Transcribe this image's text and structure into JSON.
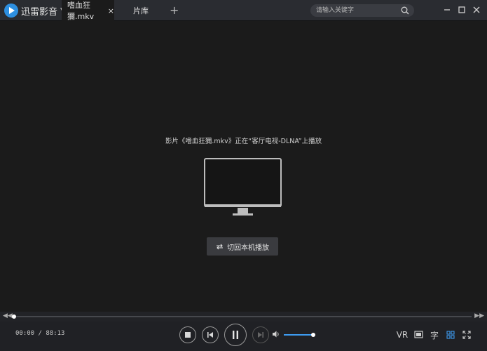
{
  "app": {
    "name": "迅雷影音",
    "brand_color": "#2d8fe0"
  },
  "tabs": [
    {
      "label": "嗜血狂獮.mkv",
      "close": "×"
    },
    {
      "label": "片库"
    }
  ],
  "tab_add": "+",
  "search": {
    "placeholder": "请输入关键字"
  },
  "cast": {
    "message": "影片《嗜血狂獮.mkv》正在“客厅电视-DLNA”上播放",
    "switch_label": "切回本机播放"
  },
  "seek": {
    "back": "◀◀",
    "forward": "▶▶",
    "progress": 0.0
  },
  "player": {
    "time": "00:00 / 88:13",
    "volume": 0.97
  },
  "right_controls": {
    "vr": "VR",
    "subtitle": "字"
  },
  "colors": {
    "accent": "#3d9bf0"
  }
}
